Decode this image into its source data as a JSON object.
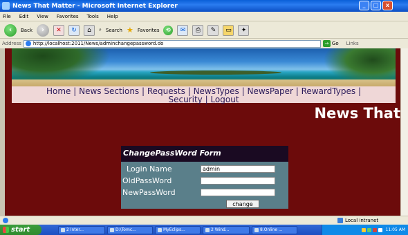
{
  "window": {
    "title": "News That Matter - Microsoft Internet Explorer"
  },
  "menu": [
    "File",
    "Edit",
    "View",
    "Favorites",
    "Tools",
    "Help"
  ],
  "toolbar": {
    "back": "Back",
    "search": "Search",
    "favorites": "Favorites"
  },
  "address": {
    "label": "Address",
    "url": "http://localhost:2011/News/adminchangepassword.do",
    "go": "Go",
    "links": "Links"
  },
  "nav": {
    "items": [
      "Home",
      "News Sections",
      "Requests",
      "NewsTypes",
      "NewsPaper",
      "RewardTypes",
      "Security",
      "Logout"
    ]
  },
  "site": {
    "title": "News That"
  },
  "form": {
    "title": "ChangePassWord Form",
    "login_label": "Login Name",
    "login_value": "admin",
    "old_label": "OldPassWord",
    "new_label": "NewPassWord",
    "submit": "change"
  },
  "status": {
    "zone": "Local intranet"
  },
  "taskbar": {
    "start": "start",
    "items": [
      "2 Inter...",
      "D:\\Tomc...",
      "MyEclips...",
      "2 Wind...",
      "8.Online ..."
    ],
    "clock": "11:05 AM"
  }
}
